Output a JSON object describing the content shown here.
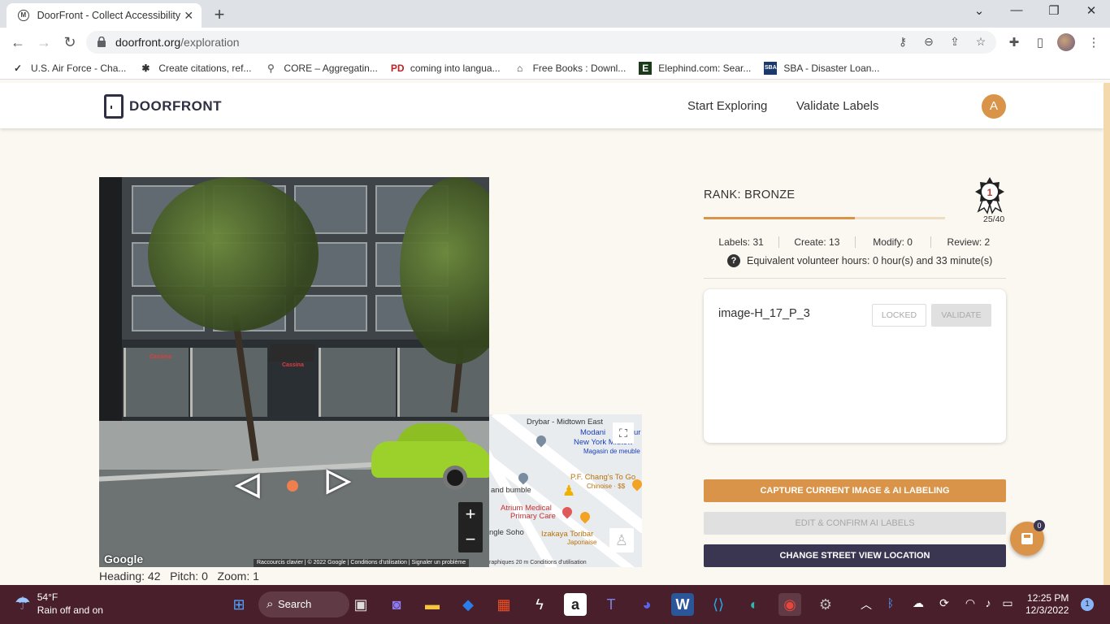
{
  "browser": {
    "tab_title": "DoorFront - Collect Accessibility I",
    "url_domain": "doorfront.org",
    "url_path": "/exploration",
    "bookmarks": [
      {
        "label": "U.S. Air Force - Cha...",
        "icon": "chevron-icon"
      },
      {
        "label": "Create citations, ref...",
        "icon": "asterisk-icon"
      },
      {
        "label": "CORE – Aggregatin...",
        "icon": "core-icon"
      },
      {
        "label": "coming into langua...",
        "icon": "pd-icon"
      },
      {
        "label": "Free Books : Downl...",
        "icon": "archive-icon"
      },
      {
        "label": "Elephind.com: Sear...",
        "icon": "elephind-icon"
      },
      {
        "label": "SBA - Disaster Loan...",
        "icon": "sba-icon"
      }
    ]
  },
  "app": {
    "logo_text": "DOORFRONT",
    "nav": {
      "explore": "Start Exploring",
      "validate": "Validate Labels"
    },
    "avatar_initial": "A"
  },
  "streetview": {
    "google_logo": "Google",
    "attribution": "Raccourcis clavier  |  © 2022 Google  |  Conditions d'utilisation  |  Signaler un problème",
    "zoom_in": "+",
    "zoom_out": "−",
    "storefront_sign": "Cassina",
    "status": "Heading: 42   Pitch: 0   Zoom: 1"
  },
  "minimap": {
    "labels": {
      "drybar": "Drybar - Midtown East",
      "modani": "Modani",
      "modani2": "ur",
      "nymidtown": "New York Midtow",
      "meuble": "Magasin de meuble",
      "pchangs": "P.F. Chang's To Go",
      "chinoise": "Chinoise · $$",
      "bumble": "and bumble",
      "atrium1": "Atrium Medical",
      "atrium2": "Primary Care",
      "soho": "ngle Soho",
      "izakaya": "Izakaya Toribar",
      "japonaise": "Japonaise",
      "attribution": "raphiques  20 m  Conditions d'utilisation"
    }
  },
  "rank": {
    "title": "RANK: BRONZE",
    "progress": "25/40",
    "progress_fraction": 0.625,
    "medal_number": "1",
    "stats": {
      "labels": "Labels: 31",
      "create": "Create: 13",
      "modify": "Modify: 0",
      "review": "Review: 2"
    },
    "hours": "Equivalent volunteer hours: 0 hour(s) and 33 minute(s)"
  },
  "card": {
    "image_name": "image-H_17_P_3",
    "locked": "LOCKED",
    "validate": "VALIDATE"
  },
  "actions": {
    "capture": "CAPTURE CURRENT IMAGE & AI LABELING",
    "edit": "EDIT & CONFIRM AI LABELS",
    "change": "CHANGE STREET VIEW LOCATION",
    "fab_badge": "0"
  },
  "taskbar": {
    "temperature": "54°F",
    "weather": "Rain off and on",
    "search": "Search",
    "time": "12:25 PM",
    "date": "12/3/2022",
    "notifications": "1"
  },
  "colors": {
    "accent": "#d9944a",
    "dark": "#3a3550",
    "taskbar": "#4a1f2c"
  }
}
